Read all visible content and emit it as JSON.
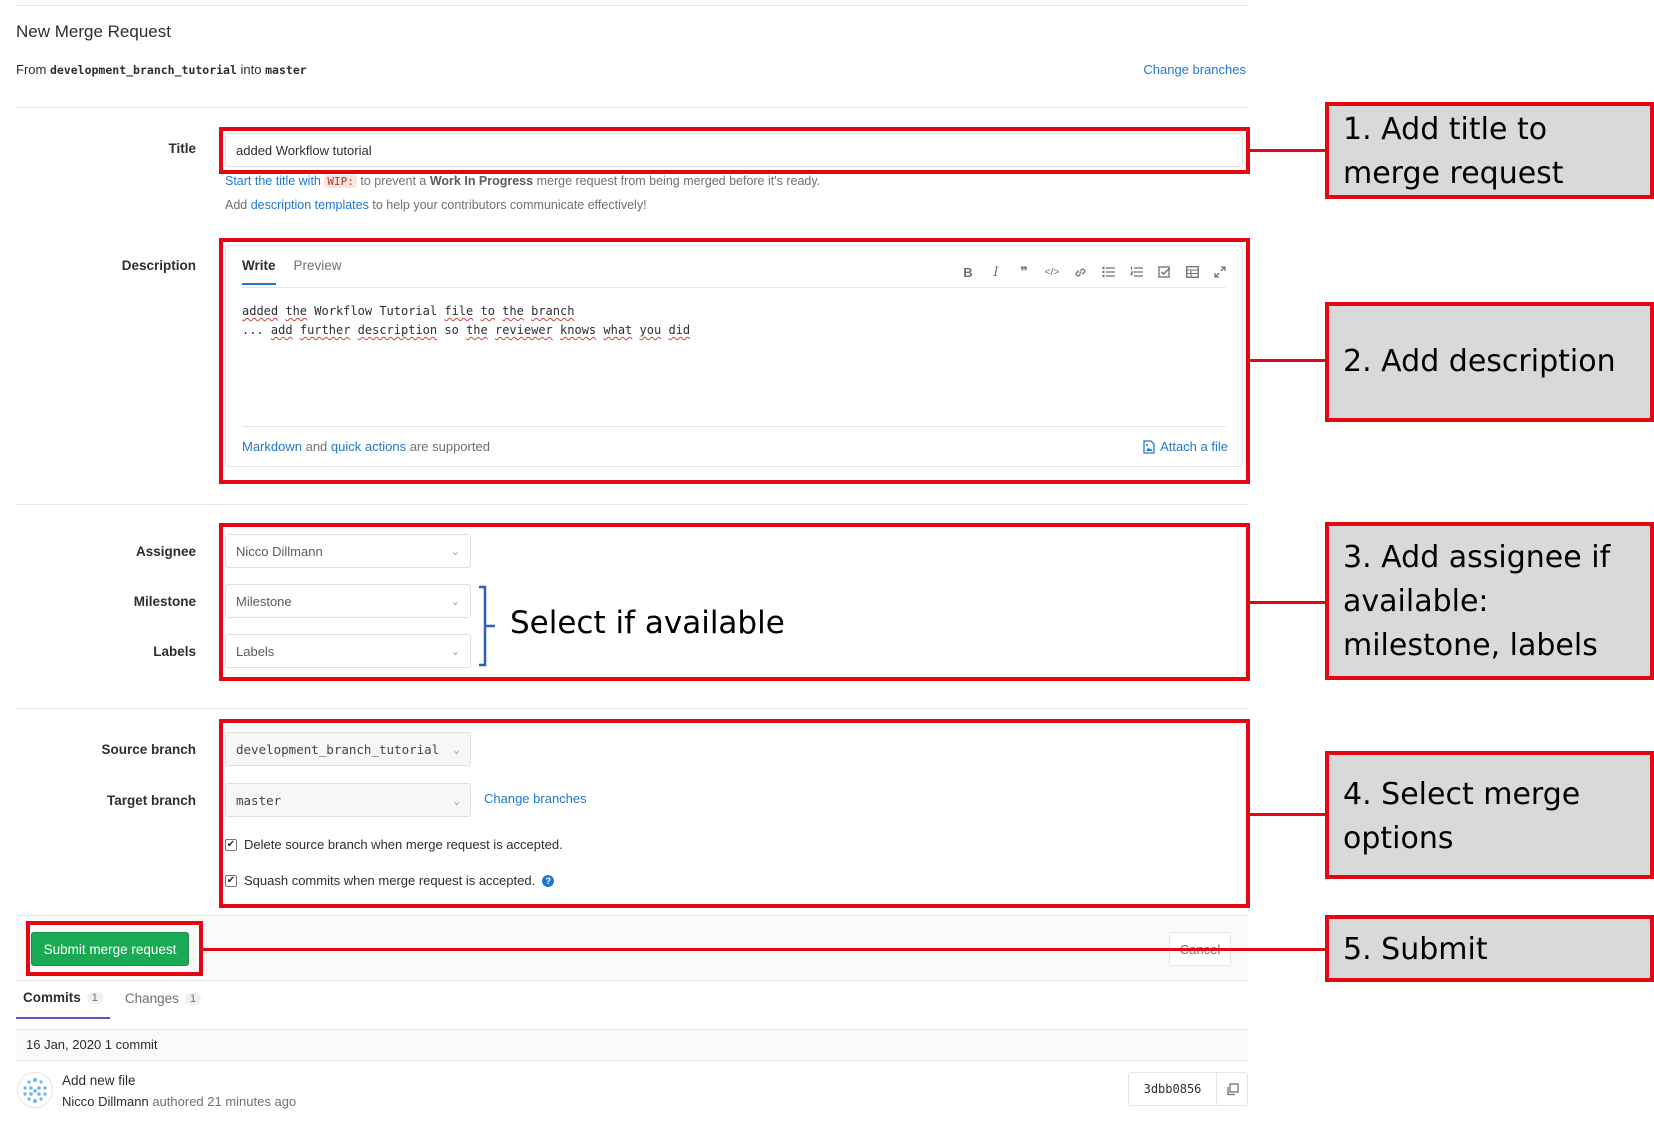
{
  "header": {
    "title": "New Merge Request",
    "from_prefix": "From",
    "source_branch": "development_branch_tutorial",
    "into_text": "into",
    "target_branch": "master",
    "change_branches": "Change branches"
  },
  "title_field": {
    "label": "Title",
    "value": "added Workflow tutorial",
    "hint1_link": "Start the title with",
    "hint1_code": "WIP:",
    "hint1_mid": "to prevent a",
    "hint1_bold": "Work In Progress",
    "hint1_end": "merge request from being merged before it's ready.",
    "hint2_start": "Add",
    "hint2_link": "description templates",
    "hint2_end": "to help your contributors communicate effectively!"
  },
  "description": {
    "label": "Description",
    "tab_write": "Write",
    "tab_preview": "Preview",
    "line1": [
      "added",
      "the",
      "Workflow",
      "Tutorial",
      "file",
      "to",
      "the",
      "branch"
    ],
    "line2": [
      "...",
      "add",
      "further",
      "description",
      "so",
      "the",
      "reviewer",
      "knows",
      "what",
      "you",
      "did"
    ],
    "footer_link1": "Markdown",
    "footer_and": "and",
    "footer_link2": "quick actions",
    "footer_end": "are supported",
    "attach": "Attach a file",
    "toolbar_icons": [
      "bold-icon",
      "italic-icon",
      "quote-icon",
      "code-icon",
      "link-icon",
      "bullet-list-icon",
      "numbered-list-icon",
      "task-list-icon",
      "table-icon",
      "fullscreen-icon"
    ]
  },
  "assignee": {
    "label": "Assignee",
    "value": "Nicco Dillmann"
  },
  "milestone": {
    "label": "Milestone",
    "value": "Milestone"
  },
  "labels": {
    "label": "Labels",
    "value": "Labels"
  },
  "select_note": "Select if available",
  "branches": {
    "source_label": "Source branch",
    "source_value": "development_branch_tutorial",
    "target_label": "Target branch",
    "target_value": "master",
    "change_branches": "Change branches",
    "delete_source": "Delete source branch when merge request is accepted.",
    "squash": "Squash commits when merge request is accepted."
  },
  "actions": {
    "submit": "Submit merge request",
    "cancel": "Cancel"
  },
  "commit_tabs": {
    "commits_label": "Commits",
    "commits_count": "1",
    "changes_label": "Changes",
    "changes_count": "1"
  },
  "commits": {
    "date_line": "16 Jan, 2020 1 commit",
    "items": [
      {
        "title": "Add new file",
        "author": "Nicco Dillmann",
        "meta": "authored 21 minutes ago",
        "sha": "3dbb0856"
      }
    ]
  },
  "annotations": {
    "step1": "1. Add title to merge request",
    "step2": "2. Add description",
    "step3": "3. Add assignee if available: milestone, labels",
    "step4": "4. Select merge options",
    "step5": "5. Submit"
  },
  "colors": {
    "annotation_red": "#e30613",
    "callout_bg": "#d9d9d9",
    "submit_green": "#1aaa55",
    "link_blue": "#1f78d1"
  }
}
